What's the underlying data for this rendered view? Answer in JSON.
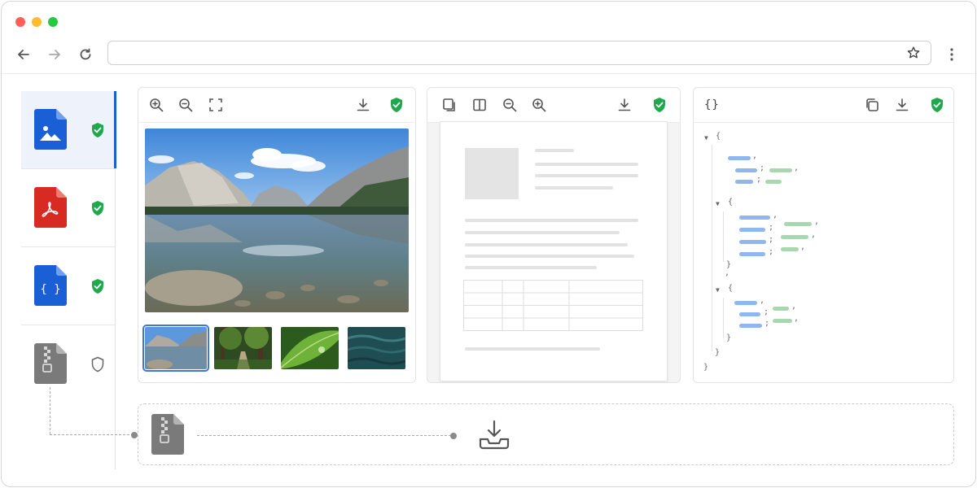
{
  "browser": {
    "address": {
      "value": "",
      "placeholder": ""
    },
    "traffic_colors": [
      "#ff5f57",
      "#febc2e",
      "#28c840"
    ],
    "icons": [
      "back-arrow-icon",
      "forward-arrow-icon",
      "reload-icon",
      "star-icon",
      "more-vertical-icon"
    ]
  },
  "sidebar": {
    "items": [
      {
        "type": "image-file",
        "status": "verified",
        "color": "#1a5fd6",
        "selected": true
      },
      {
        "type": "pdf-file",
        "status": "verified",
        "color": "#d62a23",
        "selected": false
      },
      {
        "type": "json-file",
        "status": "verified",
        "color": "#1a5fd6",
        "selected": false
      },
      {
        "type": "zip-archive",
        "status": "unverified",
        "color": "#7a7a7a",
        "selected": false
      }
    ]
  },
  "image_viewer": {
    "toolbar": [
      "zoom-in-icon",
      "zoom-out-icon",
      "fullscreen-icon",
      "download-icon",
      "verified-shield-icon"
    ],
    "thumbnails": [
      "mountain-lake",
      "forest-path",
      "green-leaf",
      "ocean-water"
    ],
    "selected_thumbnail": 0
  },
  "pdf_viewer": {
    "toolbar": [
      "page-thumbnails-icon",
      "two-page-icon",
      "zoom-out-icon",
      "zoom-in-icon",
      "download-icon",
      "verified-shield-icon"
    ]
  },
  "json_viewer": {
    "header_label": "{}",
    "toolbar": [
      "copy-icon",
      "download-icon",
      "verified-shield-icon"
    ],
    "lines": {
      "open": "{",
      "close": "}",
      "collapse": "▼"
    }
  },
  "extraction": {
    "source_icon": "zip-archive-icon",
    "target_icon": "download-tray-icon"
  },
  "colors": {
    "verified": "#1fa84c",
    "accent": "#1a5fd6",
    "json_key": "#8fb6ee",
    "json_value": "#a9d8b0"
  }
}
